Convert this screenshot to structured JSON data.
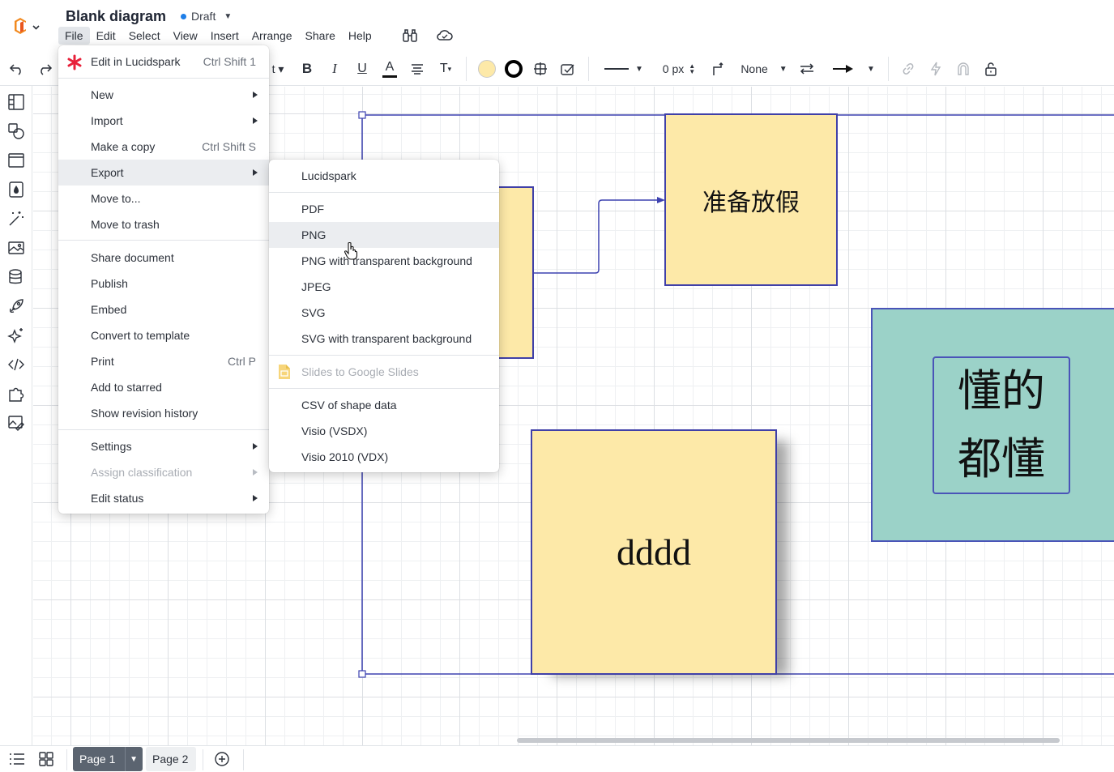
{
  "header": {
    "title": "Blank diagram",
    "status": "Draft",
    "menus": [
      "File",
      "Edit",
      "Select",
      "View",
      "Insert",
      "Arrange",
      "Share",
      "Help"
    ]
  },
  "toolbar": {
    "line_width": "0 px",
    "endpoint_style": "None",
    "fill_color": "#fde9a8"
  },
  "file_menu": {
    "edit_in_lucidspark": {
      "label": "Edit in Lucidspark",
      "shortcut": "Ctrl Shift 1"
    },
    "new": "New",
    "import": "Import",
    "make_copy": {
      "label": "Make a copy",
      "shortcut": "Ctrl Shift S"
    },
    "export": "Export",
    "move_to": "Move to...",
    "move_to_trash": "Move to trash",
    "share_document": "Share document",
    "publish": "Publish",
    "embed": "Embed",
    "convert_to_template": "Convert to template",
    "print": {
      "label": "Print",
      "shortcut": "Ctrl P"
    },
    "add_to_starred": "Add to starred",
    "show_revision_history": "Show revision history",
    "settings": "Settings",
    "assign_classification": "Assign classification",
    "edit_status": "Edit status"
  },
  "export_menu": {
    "lucidspark": "Lucidspark",
    "pdf": "PDF",
    "png": "PNG",
    "png_transparent": "PNG with transparent background",
    "jpeg": "JPEG",
    "svg": "SVG",
    "svg_transparent": "SVG with transparent background",
    "slides": "Slides to Google Slides",
    "csv": "CSV of shape data",
    "vsdx": "Visio (VSDX)",
    "vdx": "Visio 2010 (VDX)"
  },
  "canvas": {
    "note_vacation": "准备放假",
    "note_dddd": "dddd",
    "teal_text_line1": "懂的",
    "teal_text_line2": "都懂"
  },
  "pages": {
    "page1": "Page 1",
    "page2": "Page 2"
  }
}
